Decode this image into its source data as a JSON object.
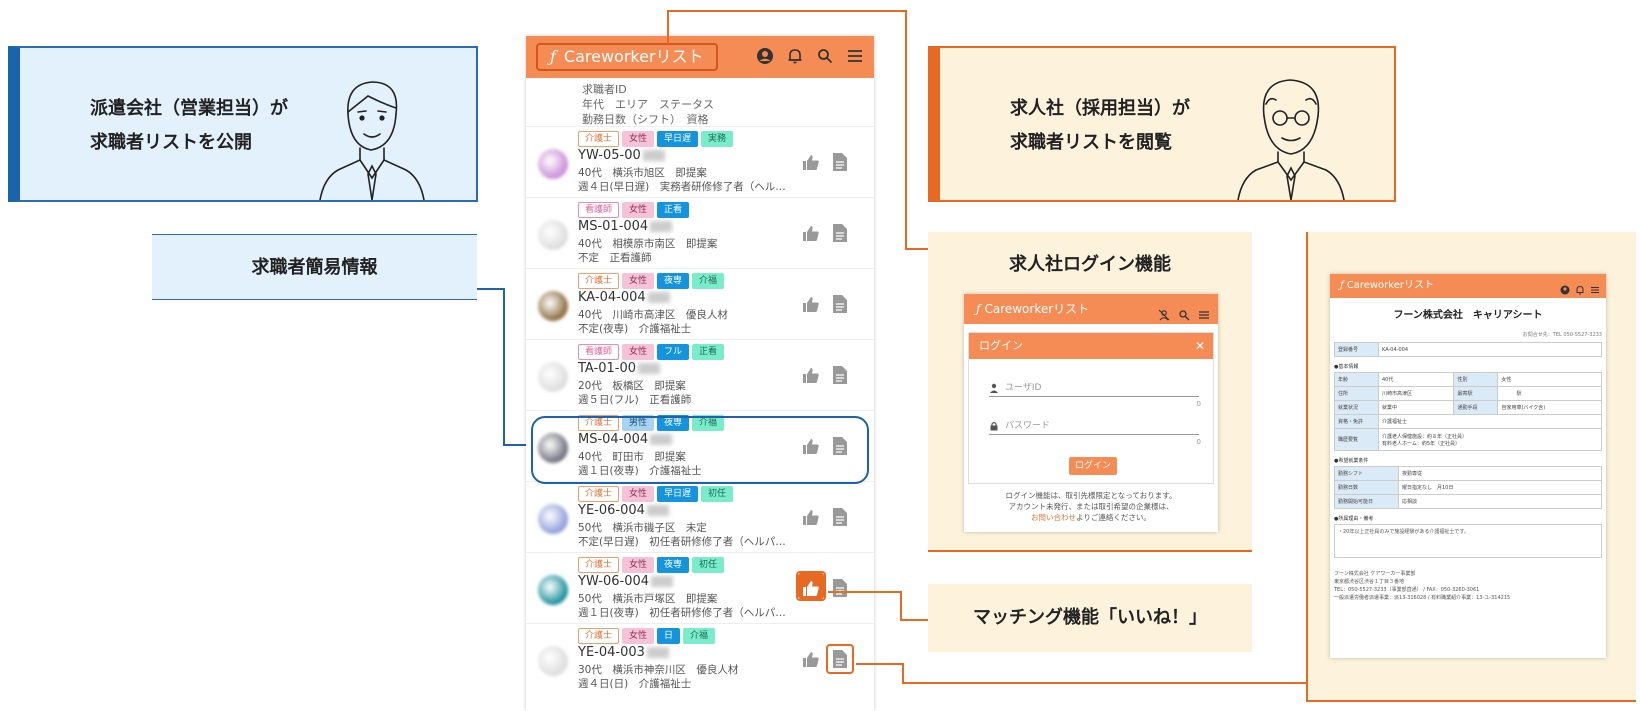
{
  "seller_callout": {
    "line1": "派遣会社（営業担当）が",
    "line2": "求職者リストを公開"
  },
  "simple_info_label": "求職者簡易情報",
  "buyer_callout": {
    "line1": "求人社（採用担当）が",
    "line2": "求職者リストを閲覧"
  },
  "app": {
    "logo_glyph": "ƒ",
    "title": "Careworkerリスト"
  },
  "filter_header": {
    "line1": "求職者ID",
    "line2": "年代　エリア　ステータス",
    "line3": "勤務日数（シフト）　資格"
  },
  "candidates": [
    {
      "tags": [
        "介護士",
        "女性",
        "早日遅",
        "実務"
      ],
      "id": "YW-05-00",
      "line1": "40代　横浜市旭区　即提案",
      "line2": "週４日(早日遅)　実務者研修修了者（ヘルパ…",
      "avatar_color": "#c98bd6"
    },
    {
      "tags": [
        "看護師",
        "女性",
        "正看"
      ],
      "id": "MS-01-004",
      "line1": "40代　相模原市南区　即提案",
      "line2": "不定　正看護師",
      "avatar_color": "#dcdcdc"
    },
    {
      "tags": [
        "介護士",
        "女性",
        "夜専",
        "介福"
      ],
      "id": "KA-04-004",
      "line1": "40代　川崎市高津区　優良人材",
      "line2": "不定(夜専)　介護福祉士",
      "avatar_color": "#8a6a3a"
    },
    {
      "tags": [
        "看護師",
        "女性",
        "フル",
        "正看"
      ],
      "id": "TA-01-00",
      "line1": "20代　板橋区　即提案",
      "line2": "週５日(フル)　正看護師",
      "avatar_color": "#dcdcdc"
    },
    {
      "tags": [
        "介護士",
        "男性",
        "夜専",
        "介福"
      ],
      "id": "MS-04-004",
      "line1": "40代　町田市　即提案",
      "line2": "週１日(夜専)　介護福祉士",
      "avatar_color": "#6d6f7a"
    },
    {
      "tags": [
        "介護士",
        "女性",
        "早日遅",
        "初任"
      ],
      "id": "YE-06-004",
      "line1": "50代　横浜市磯子区　未定",
      "line2": "不定(早日遅)　初任者研修修了者（ヘルパー…",
      "avatar_color": "#8c9cd9"
    },
    {
      "tags": [
        "介護士",
        "女性",
        "夜専",
        "初任"
      ],
      "id": "YW-06-004",
      "line1": "50代　横浜市戸塚区　即提案",
      "line2": "週１日(夜専)　初任者研修修了者（ヘルパー…",
      "avatar_color": "#168f9a"
    },
    {
      "tags": [
        "介護士",
        "女性",
        "日",
        "介福"
      ],
      "id": "YE-04-003",
      "line1": "30代　横浜市神奈川区　優良人材",
      "line2": "週４日(日)　介護福祉士",
      "avatar_color": "#dcdcdc"
    }
  ],
  "login_feature": {
    "title": "求人社ログイン機能",
    "app_title": "Careworkerリスト",
    "dialog_title": "ログイン",
    "close": "✕",
    "user_placeholder": "ユーザID",
    "password_placeholder": "パスワード",
    "counter": "0",
    "button": "ログイン",
    "note1": "ログイン機能は、取引先様限定となっております。",
    "note2": "アカウント未発行、または取引希望の企業様は、",
    "note3_link": "お問い合わせ",
    "note3_rest": "よりご連絡ください。"
  },
  "matching_label": "マッチング機能「いいね！」",
  "career_sheet": {
    "app_title": "Careworkerリスト",
    "title": "フーン株式会社　キャリアシート",
    "contact": "お問合せ先：TEL 050-5527-3233",
    "reg_label": "登録番号",
    "reg_value": "KA-04-004",
    "basic_section": "●基本情報",
    "basic_rows": [
      [
        "年齢",
        "40代",
        "性別",
        "女性"
      ],
      [
        "住所",
        "川崎市高津区",
        "最寄駅",
        "　　　駅"
      ],
      [
        "就業状況",
        "就業中",
        "通勤手段",
        "自家用車(バイク含)"
      ]
    ],
    "qual_label": "資格・免許",
    "qual_value": "介護福祉士",
    "hist_label": "職歴要覧",
    "hist_value1": "介護老人保健施設：約８年（正社員）",
    "hist_value2": "有料老人ホーム：約5年（正社員）",
    "wish_section": "●希望就業条件",
    "wish_rows": [
      [
        "勤務シフト",
        "夜勤専従"
      ],
      [
        "勤務日数",
        "曜日指定なし　月10日"
      ],
      [
        "勤務開始可能日",
        "応相談"
      ]
    ],
    "memo_section": "●所属理由・備考",
    "memo_text": "・20年以上正社員のみで施設経験がある介護福祉士です。",
    "footer1": "フーン株式会社 ケアワーカー事業部",
    "footer2": "東京都渋谷区渋谷１丁目３番地",
    "footer3": "TEL：050-5527-3233（事業部直通） / FAX：050-3260-3061",
    "footer4": "一般派遣労働者派遣事業：派13-316028 / 有料職業紹介事業：13-ユ-314215"
  },
  "colors": {
    "accent": "#f58b55",
    "orange_line": "#e86a22",
    "blue_line": "#1b63ad",
    "blue_bg": "#e3f1fc",
    "cream_bg": "#fdf3dd"
  }
}
